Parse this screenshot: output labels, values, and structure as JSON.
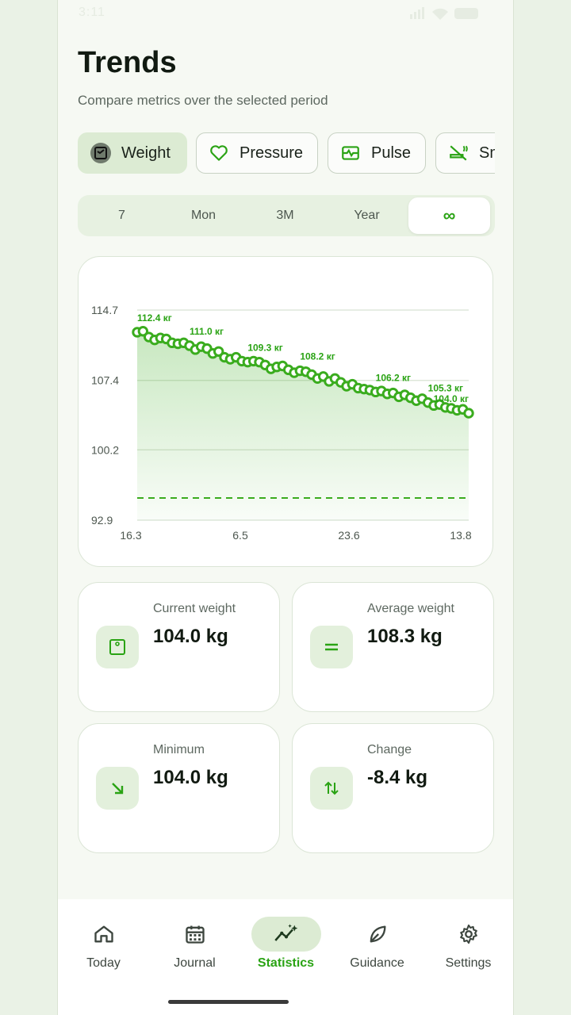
{
  "status_bar": {
    "time": "3:11"
  },
  "header": {
    "title": "Trends",
    "subtitle": "Compare metrics over the selected period"
  },
  "metric_tabs": [
    {
      "label": "Weight",
      "icon": "scale-icon",
      "active": true
    },
    {
      "label": "Pressure",
      "icon": "heart-icon",
      "active": false
    },
    {
      "label": "Pulse",
      "icon": "pulse-icon",
      "active": false
    },
    {
      "label": "Sm",
      "icon": "smoking-icon",
      "active": false
    }
  ],
  "period": [
    {
      "label": "7",
      "active": false
    },
    {
      "label": "Mon",
      "active": false
    },
    {
      "label": "3M",
      "active": false
    },
    {
      "label": "Year",
      "active": false
    },
    {
      "label": "∞",
      "active": true
    }
  ],
  "chart_data": {
    "type": "line",
    "x_labels": [
      "16.3",
      "6.5",
      "23.6",
      "13.8"
    ],
    "y_ticks": [
      "114.7",
      "107.4",
      "100.2",
      "92.9"
    ],
    "ylim": [
      92.9,
      114.7
    ],
    "target_line": 95.2,
    "values": [
      112.4,
      112.5,
      111.9,
      111.6,
      111.8,
      111.7,
      111.3,
      111.2,
      111.3,
      111.0,
      110.6,
      110.9,
      110.7,
      110.2,
      110.4,
      109.8,
      109.6,
      109.8,
      109.4,
      109.3,
      109.4,
      109.3,
      109.0,
      108.6,
      108.8,
      108.9,
      108.5,
      108.2,
      108.4,
      108.3,
      108.0,
      107.6,
      107.8,
      107.3,
      107.6,
      107.2,
      106.8,
      107.0,
      106.6,
      106.5,
      106.4,
      106.2,
      106.3,
      106.0,
      106.1,
      105.7,
      105.9,
      105.6,
      105.3,
      105.5,
      105.1,
      104.8,
      104.9,
      104.6,
      104.5,
      104.3,
      104.4,
      104.0
    ],
    "annotations": [
      {
        "index": 0,
        "label": "112.4 кг"
      },
      {
        "index": 9,
        "label": "111.0 кг"
      },
      {
        "index": 19,
        "label": "109.3 кг"
      },
      {
        "index": 28,
        "label": "108.2 кг"
      },
      {
        "index": 41,
        "label": "106.2 кг"
      },
      {
        "index": 50,
        "label": "105.3 кг"
      },
      {
        "index": 57,
        "label": "104.0 кг"
      }
    ],
    "color": "#3aac1e"
  },
  "stats": [
    {
      "label": "Current weight",
      "value": "104.0 kg",
      "icon": "scale-icon"
    },
    {
      "label": "Average weight",
      "value": "108.3 kg",
      "icon": "equals-icon"
    },
    {
      "label": "Minimum",
      "value": "104.0 kg",
      "icon": "arrow-down-right-icon"
    },
    {
      "label": "Change",
      "value": "-8.4 kg",
      "icon": "swap-vertical-icon"
    }
  ],
  "nav": [
    {
      "label": "Today",
      "icon": "home-icon",
      "active": false
    },
    {
      "label": "Journal",
      "icon": "calendar-icon",
      "active": false
    },
    {
      "label": "Statistics",
      "icon": "chart-icon",
      "active": true
    },
    {
      "label": "Guidance",
      "icon": "leaf-icon",
      "active": false
    },
    {
      "label": "Settings",
      "icon": "gear-icon",
      "active": false
    }
  ],
  "colors": {
    "accent": "#2aa314",
    "active_bg": "#dcebd3",
    "line": "#3aac1e"
  }
}
